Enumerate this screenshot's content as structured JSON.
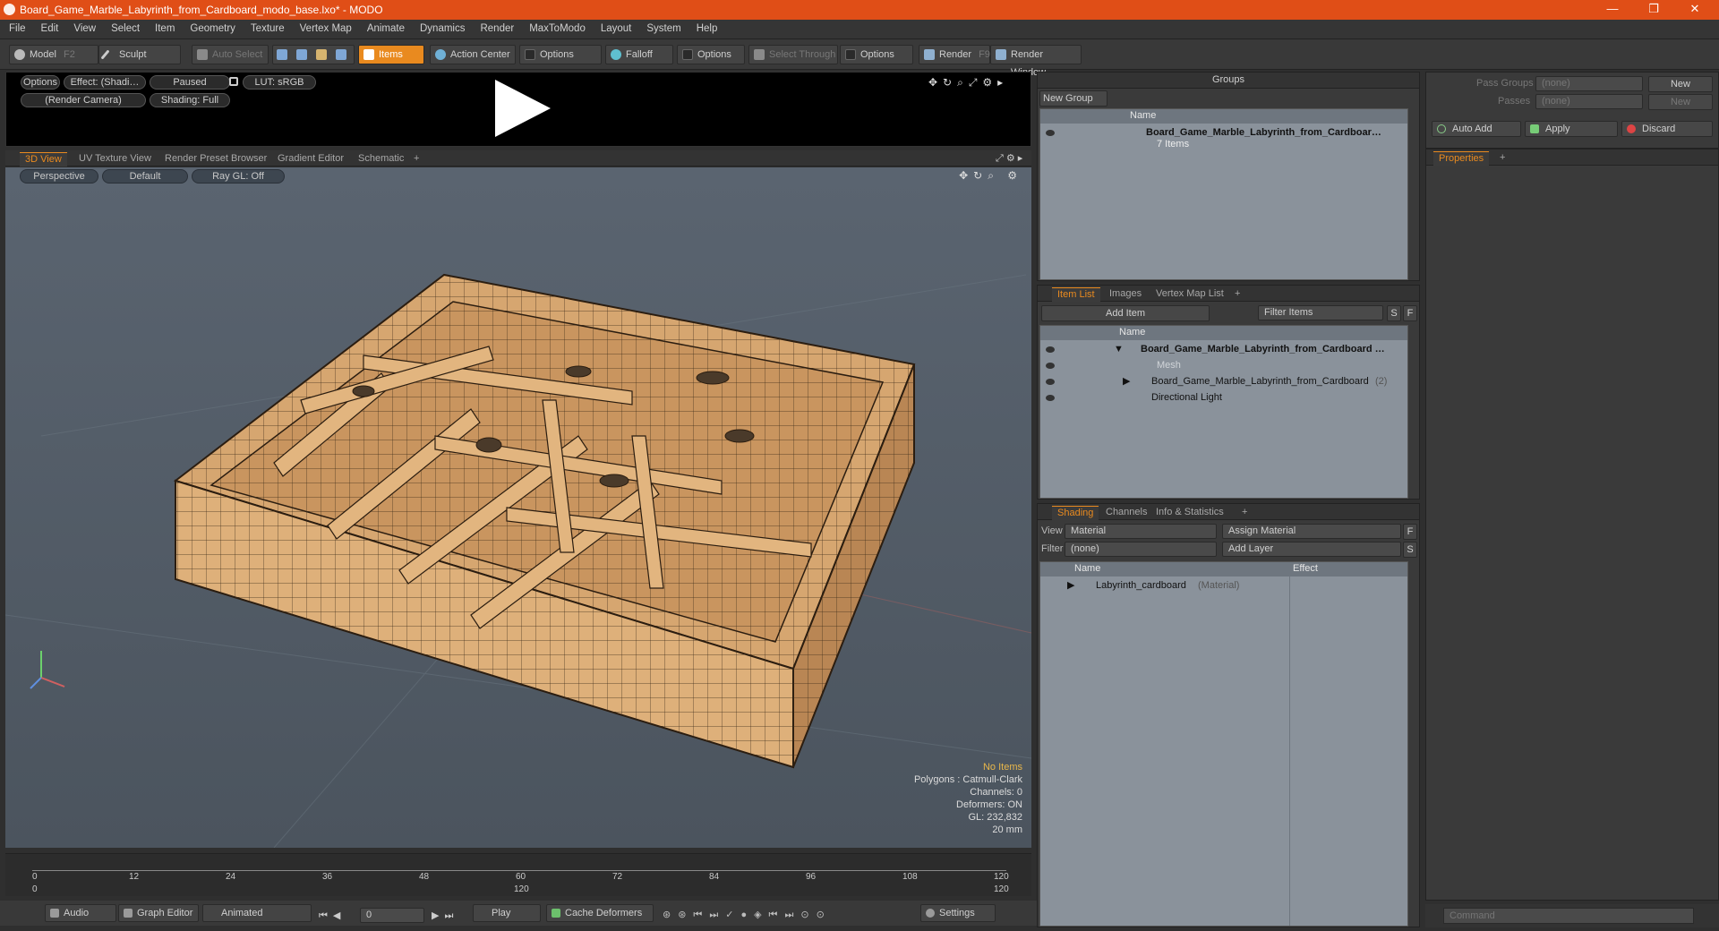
{
  "window": {
    "title": "Board_Game_Marble_Labyrinth_from_Cardboard_modo_base.lxo* - MODO",
    "minimize": "—",
    "restore": "❐",
    "close": "✕"
  },
  "menu": [
    "File",
    "Edit",
    "View",
    "Select",
    "Item",
    "Geometry",
    "Texture",
    "Vertex Map",
    "Animate",
    "Dynamics",
    "Render",
    "MaxToModo",
    "Layout",
    "System",
    "Help"
  ],
  "toolbar": {
    "model": "Model",
    "model_key": "F2",
    "sculpt": "Sculpt",
    "auto_select": "Auto Select",
    "items": "Items",
    "action_center": "Action Center",
    "options1": "Options",
    "falloff": "Falloff",
    "options2": "Options",
    "select_through": "Select Through",
    "options3": "Options",
    "render": "Render",
    "render_key": "F9",
    "render_window": "Render Window"
  },
  "preview": {
    "options": "Options",
    "effect": "Effect: (Shadi…",
    "paused": "Paused",
    "lut": "LUT: sRGB",
    "camera": "(Render Camera)",
    "shading": "Shading: Full"
  },
  "view_tabs": [
    "3D View",
    "UV Texture View",
    "Render Preset Browser",
    "Gradient Editor",
    "Schematic"
  ],
  "viewport": {
    "perspective": "Perspective",
    "default": "Default",
    "raygl": "Ray GL: Off",
    "stats": [
      "No Items",
      "Polygons : Catmull-Clark",
      "Channels: 0",
      "Deformers: ON",
      "GL: 232,832",
      "20 mm"
    ]
  },
  "timeline": {
    "ticks": [
      "0",
      "12",
      "24",
      "36",
      "48",
      "60",
      "72",
      "84",
      "96",
      "108",
      "120"
    ],
    "sub_ticks": [
      "0",
      "120",
      "120"
    ]
  },
  "transport": {
    "audio": "Audio",
    "graph_editor": "Graph Editor",
    "animated": "Animated",
    "frame": "0",
    "play": "Play",
    "cache_deformers": "Cache Deformers",
    "settings": "Settings"
  },
  "groups": {
    "title": "Groups",
    "new_group": "New Group",
    "col_name": "Name",
    "item_name": "Board_Game_Marble_Labyrinth_from_Cardboar…",
    "item_sub": "7 Items"
  },
  "passes": {
    "pass_groups": "Pass Groups",
    "passes": "Passes",
    "none1": "(none)",
    "none2": "(none)",
    "new1": "New",
    "new2": "New"
  },
  "actions": {
    "auto_add": "Auto Add",
    "apply": "Apply",
    "discard": "Discard"
  },
  "properties_tab": "Properties",
  "item_list": {
    "tabs": [
      "Item List",
      "Images",
      "Vertex Map List"
    ],
    "add_item": "Add Item",
    "filter_items": "Filter Items",
    "s": "S",
    "f": "F",
    "col_name": "Name",
    "rows": [
      {
        "name": "Board_Game_Marble_Labyrinth_from_Cardboard …",
        "extra": ""
      },
      {
        "name": "Mesh",
        "extra": ""
      },
      {
        "name": "Board_Game_Marble_Labyrinth_from_Cardboard",
        "extra": "(2)"
      },
      {
        "name": "Directional Light",
        "extra": ""
      }
    ]
  },
  "shading": {
    "tabs": [
      "Shading",
      "Channels",
      "Info & Statistics"
    ],
    "view_label": "View",
    "view_value": "Material",
    "assign_material": "Assign Material",
    "f": "F",
    "filter_label": "Filter",
    "filter_value": "(none)",
    "add_layer": "Add Layer",
    "s": "S",
    "col_name": "Name",
    "col_effect": "Effect",
    "row_name": "Labyrinth_cardboard",
    "row_extra": "(Material)"
  },
  "command": {
    "placeholder": "Command"
  }
}
